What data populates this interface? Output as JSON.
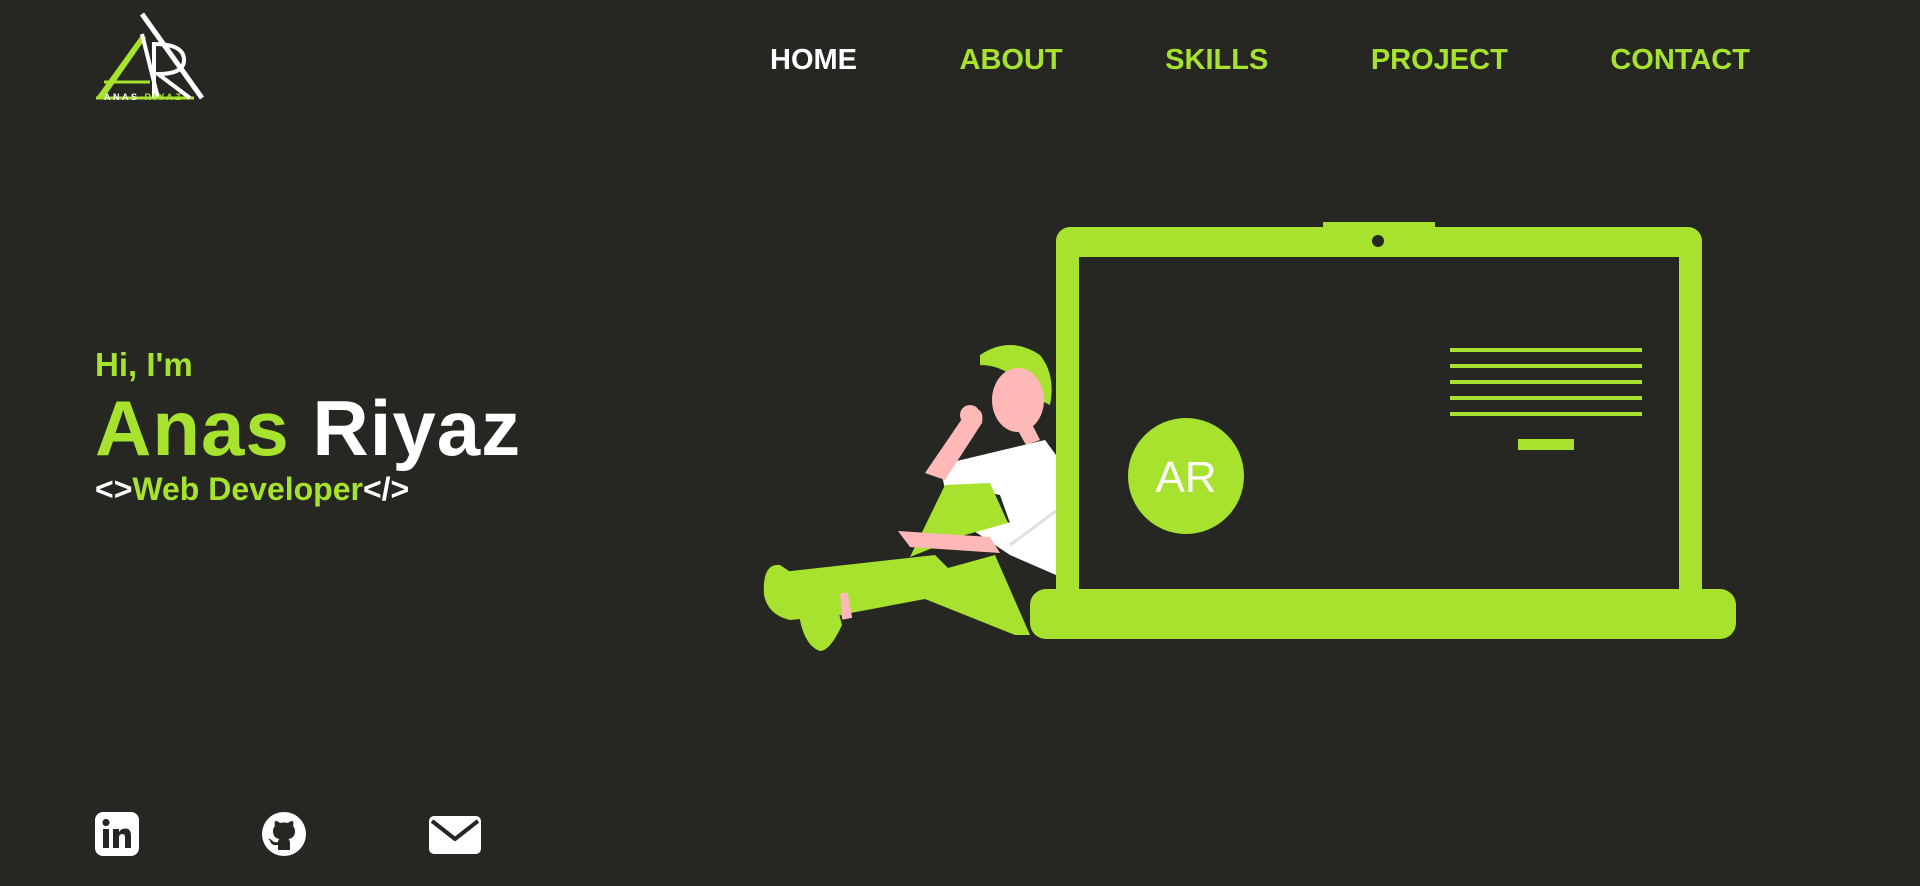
{
  "brand": {
    "logo_monogram": "AR",
    "logo_first": "ANAS",
    "logo_last": "RIYAZ"
  },
  "nav": {
    "items": [
      {
        "label": "HOME",
        "active": true
      },
      {
        "label": "ABOUT",
        "active": false
      },
      {
        "label": "SKILLS",
        "active": false
      },
      {
        "label": "PROJECT",
        "active": false
      },
      {
        "label": "CONTACT",
        "active": false
      }
    ]
  },
  "hero": {
    "greeting": "Hi, I'm",
    "first_name": "Anas",
    "last_name": "Riyaz",
    "open_tag": "<>",
    "role": "Web Developer",
    "close_tag": "</>"
  },
  "illustration": {
    "screen_badge": "AR"
  },
  "socials": [
    {
      "icon": "linkedin-icon"
    },
    {
      "icon": "github-icon"
    },
    {
      "icon": "mail-icon"
    }
  ],
  "colors": {
    "background": "#262722",
    "accent": "#a6e22e",
    "text": "#ffffff",
    "skin": "#ffb8b8"
  }
}
